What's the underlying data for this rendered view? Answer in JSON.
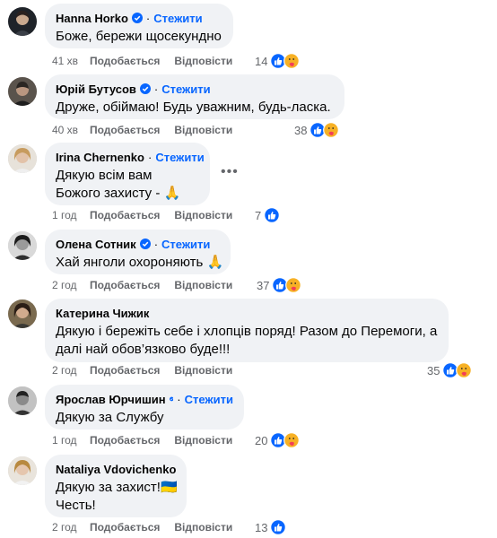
{
  "follow_label": "Стежити",
  "like_label": "Подобається",
  "reply_label": "Відповісти",
  "comments": [
    {
      "author": "Hanna Horko",
      "verified": true,
      "follow": true,
      "lines": [
        "Боже, бережи щосекундно"
      ],
      "time": "41 хв",
      "reactions": "14",
      "icons": [
        "like-icon",
        "care-icon"
      ]
    },
    {
      "author": "Юрій Бутусов",
      "verified": true,
      "follow": true,
      "lines": [
        "Друже, обіймаю! Будь уважним, будь-ласка."
      ],
      "time": "40 хв",
      "reactions": "38",
      "icons": [
        "like-icon",
        "care-icon"
      ]
    },
    {
      "author": "Irina Chernenko",
      "verified": false,
      "follow": true,
      "lines": [
        "Дякую всім вам",
        "Божого захисту - 🙏"
      ],
      "time": "1 год",
      "reactions": "7",
      "icons": [
        "like-icon"
      ]
    },
    {
      "author": "Олена Сотник",
      "verified": true,
      "follow": true,
      "lines": [
        "Хай янголи охороняють 🙏"
      ],
      "time": "2 год",
      "reactions": "37",
      "icons": [
        "like-icon",
        "care-icon"
      ]
    },
    {
      "author": "Катерина Чижик",
      "verified": false,
      "follow": false,
      "lines": [
        "Дякую і бережіть себе і хлопців поряд! Разом до Перемоги, а",
        "далі най обов’язково буде!!!"
      ],
      "time": "2 год",
      "reactions": "35",
      "icons": [
        "like-icon",
        "care-icon"
      ]
    },
    {
      "author": "Ярослав Юрчишин",
      "verified": true,
      "follow": true,
      "lines": [
        "Дякую за Службу"
      ],
      "time": "1 год",
      "reactions": "20",
      "icons": [
        "like-icon",
        "care-icon"
      ]
    },
    {
      "author": "Nataliya Vdovichenko",
      "verified": false,
      "follow": false,
      "lines": [
        "Дякую за захист!🇺🇦",
        "Честь!"
      ],
      "time": "2 год",
      "reactions": "13",
      "icons": [
        "like-icon"
      ]
    }
  ],
  "colors": {
    "accent": "#0866ff",
    "bubble": "#f0f2f5",
    "meta": "#65676b",
    "care": "#f7b125"
  }
}
